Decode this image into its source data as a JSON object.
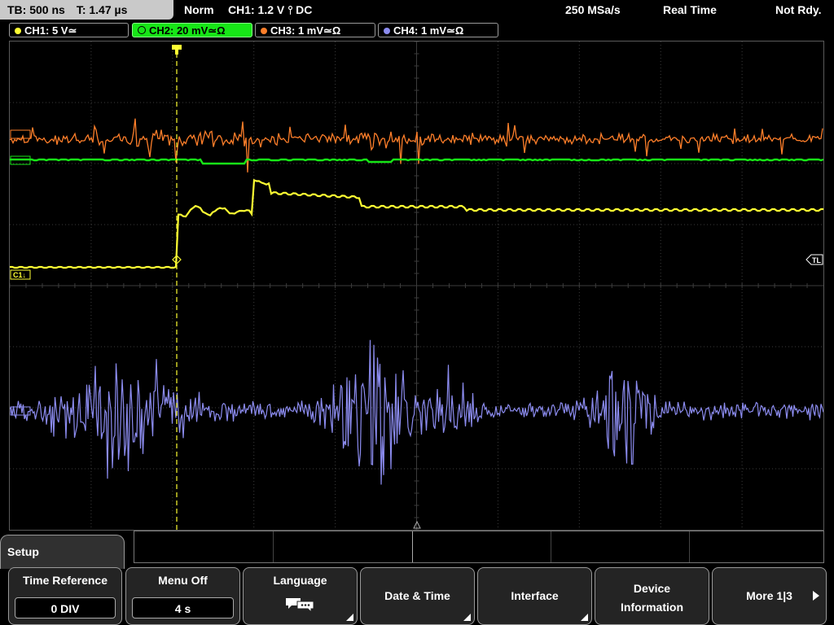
{
  "status": {
    "timebase": "TB: 500 ns",
    "trigger_time": "T: 1.47 µs",
    "trigger_mode": "Norm",
    "trigger_info": "CH1: 1.2 V ⫯ DC",
    "sample_rate": "250 MSa/s",
    "acq_mode": "Real Time",
    "state": "Not Rdy."
  },
  "channels": [
    {
      "label": "CH1: 5 V≃",
      "color": "#ffff33",
      "active": false
    },
    {
      "label": "CH2: 20 mV≃Ω",
      "color": "#17e617",
      "active": true
    },
    {
      "label": "CH3: 1 mV≃Ω",
      "color": "#ff7f2a",
      "active": false
    },
    {
      "label": "CH4: 1 mV≃Ω",
      "color": "#8c8cf0",
      "active": false
    }
  ],
  "markers": {
    "ch1": "C1↓",
    "trigger_level": "TL"
  },
  "menu": {
    "title": "Setup",
    "time_reference": {
      "label": "Time Reference",
      "value": "0 DIV"
    },
    "menu_off": {
      "label": "Menu Off",
      "value": "4 s"
    },
    "language": {
      "label": "Language",
      "icon": "speech-bubbles-icon"
    },
    "date_time": {
      "label": "Date & Time"
    },
    "interface": {
      "label": "Interface"
    },
    "device_info": {
      "line1": "Device",
      "line2": "Information"
    },
    "more": {
      "label": "More 1|3"
    }
  },
  "colors": {
    "ch1": "#ffff33",
    "ch2": "#17e617",
    "ch3": "#ff7f2a",
    "ch4": "#8c8cf0",
    "grid": "#3c3c3c",
    "trigger": "#ffff33"
  }
}
